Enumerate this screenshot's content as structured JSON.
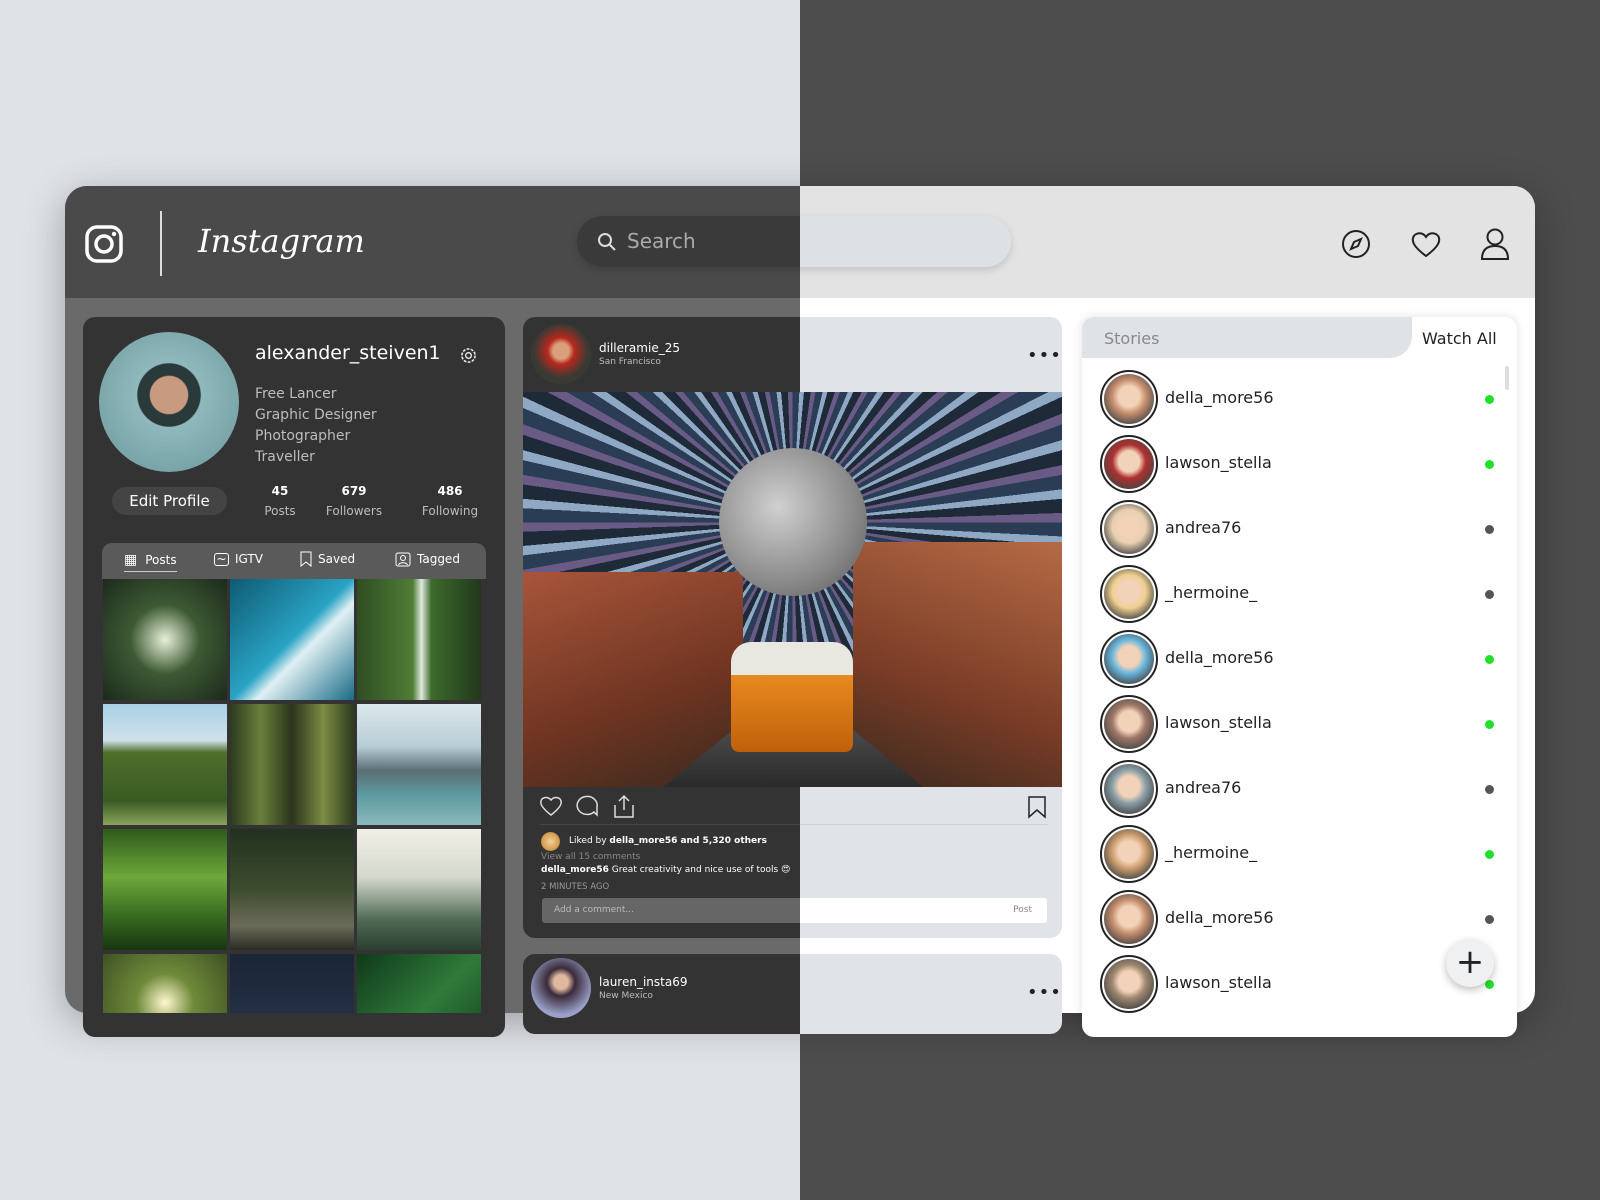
{
  "header": {
    "logo_text": "Instagram",
    "search_placeholder": "Search",
    "icons": [
      "instagram-icon",
      "compass-icon",
      "heart-icon",
      "user-icon"
    ]
  },
  "profile": {
    "username": "alexander_steiven1",
    "bio": [
      "Free Lancer",
      "Graphic Designer",
      "Photographer",
      "Traveller"
    ],
    "edit_label": "Edit Profile",
    "stats": [
      {
        "value": "45",
        "label": "Posts"
      },
      {
        "value": "679",
        "label": "Followers"
      },
      {
        "value": "486",
        "label": "Following"
      }
    ],
    "tabs": [
      {
        "label": "Posts",
        "icon": "grid-icon"
      },
      {
        "label": "IGTV",
        "icon": "tv-icon"
      },
      {
        "label": "Saved",
        "icon": "bookmark-icon"
      },
      {
        "label": "Tagged",
        "icon": "tag-user-icon"
      }
    ]
  },
  "post": {
    "username": "dilleramie_25",
    "location": "San Francisco",
    "liked_prefix": "Liked by ",
    "liked_user": "della_more56",
    "liked_suffix": " and 5,320 others",
    "view_comments": "View all 15 comments",
    "comment_user": "della_more56",
    "comment_text": "Great creativity and nice use of tools 😍",
    "time": "2 MINUTES AGO",
    "comment_placeholder": "Add a comment...",
    "post_label": "Post"
  },
  "post2": {
    "username": "lauren_insta69",
    "location": "New Mexico"
  },
  "stories": {
    "title": "Stories",
    "watch_all": "Watch All",
    "items": [
      {
        "name": "della_more56",
        "online": true
      },
      {
        "name": "lawson_stella",
        "online": true
      },
      {
        "name": "andrea76",
        "online": false
      },
      {
        "name": "_hermoine_",
        "online": false
      },
      {
        "name": "della_more56",
        "online": true
      },
      {
        "name": "lawson_stella",
        "online": true
      },
      {
        "name": "andrea76",
        "online": false
      },
      {
        "name": "_hermoine_",
        "online": true
      },
      {
        "name": "della_more56",
        "online": false
      },
      {
        "name": "lawson_stella",
        "online": true
      }
    ]
  },
  "colors": {
    "online": "#22e02a",
    "offline": "#555555"
  }
}
